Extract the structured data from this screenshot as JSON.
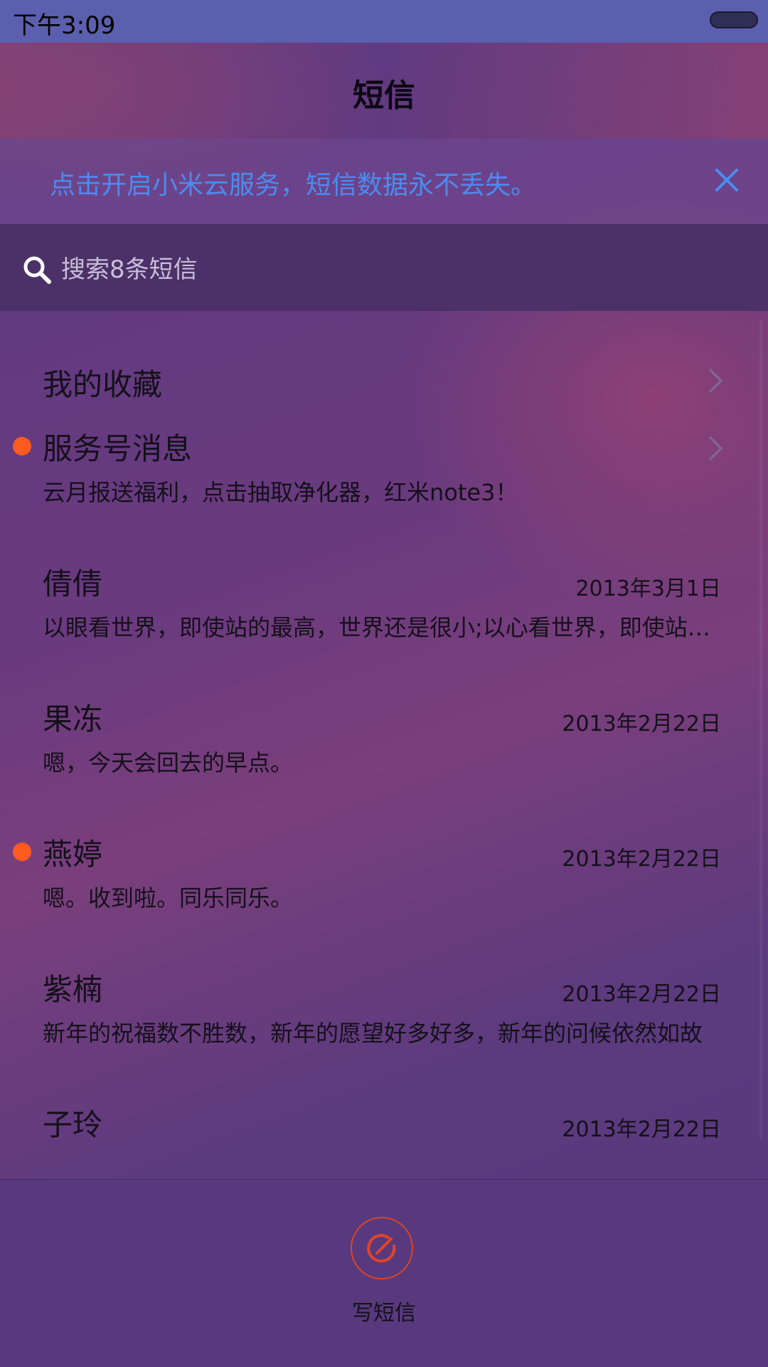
{
  "status_bar": {
    "time": "下午3:09"
  },
  "header": {
    "title": "短信"
  },
  "cloud_banner": {
    "text": "点击开启小米云服务，短信数据永不丢失。"
  },
  "search": {
    "placeholder": "搜索8条短信"
  },
  "list": {
    "favorites": {
      "title": "我的收藏"
    },
    "service": {
      "title": "服务号消息",
      "preview": "云月报送福利，点击抽取净化器，红米note3！",
      "unread": true
    },
    "conversations": [
      {
        "name": "倩倩",
        "date": "2013年3月1日",
        "preview": "以眼看世界，即使站的最高，世界还是很小;以心看世界，即使站的最低，世界也是很大",
        "unread": false
      },
      {
        "name": "果冻",
        "date": "2013年2月22日",
        "preview": "嗯，今天会回去的早点。",
        "unread": false
      },
      {
        "name": "燕婷",
        "date": "2013年2月22日",
        "preview": "嗯。收到啦。同乐同乐。",
        "unread": true
      },
      {
        "name": "紫楠",
        "date": "2013年2月22日",
        "preview": "新年的祝福数不胜数，新年的愿望好多好多，新年的问候依然如故",
        "unread": false
      },
      {
        "name": "子玲",
        "date": "2013年2月22日",
        "preview": "",
        "unread": false
      }
    ]
  },
  "bottom_bar": {
    "compose_label": "写短信"
  },
  "colors": {
    "status_bar": "#5b5fae",
    "search_bar": "#4b3168",
    "banner_text": "#4a8cf0",
    "unread_dot": "#ff5a1f",
    "compose_accent": "#d8442c"
  },
  "icons": [
    "battery-icon",
    "close-icon",
    "search-icon",
    "chevron-right-icon",
    "compose-icon"
  ]
}
